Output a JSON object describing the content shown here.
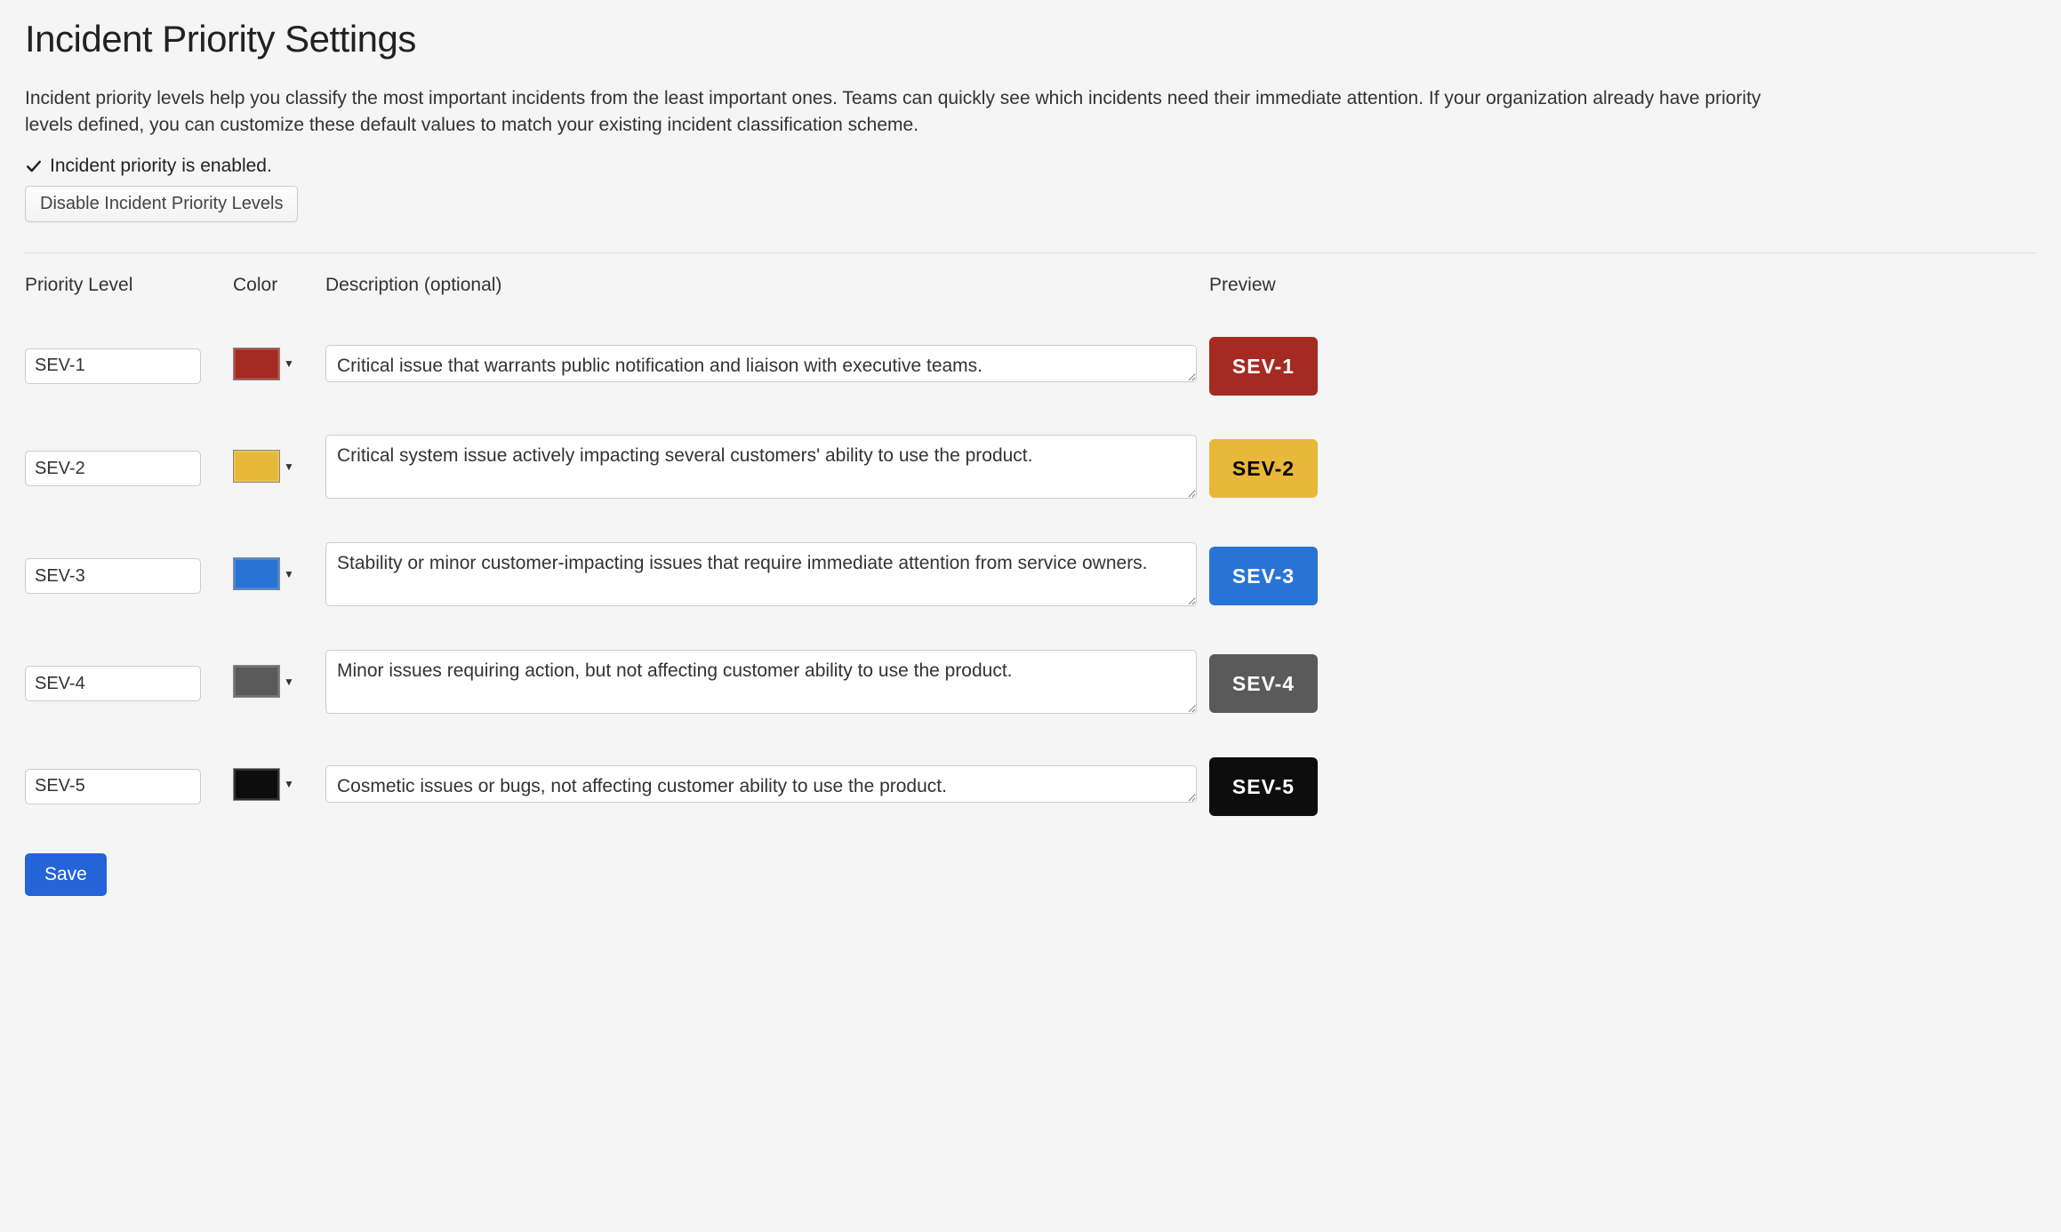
{
  "page": {
    "title": "Incident Priority Settings",
    "intro": "Incident priority levels help you classify the most important incidents from the least important ones. Teams can quickly see which incidents need their immediate attention. If your organization already have priority levels defined, you can customize these default values to match your existing incident classification scheme.",
    "status_text": "Incident priority is enabled.",
    "disable_button": "Disable Incident Priority Levels",
    "save_button": "Save"
  },
  "columns": {
    "name": "Priority Level",
    "color": "Color",
    "description": "Description (optional)",
    "preview": "Preview"
  },
  "priorities": [
    {
      "name": "SEV-1",
      "color": "#a52a21",
      "text_color": "#ffffff",
      "description": "Critical issue that warrants public notification and liaison with executive teams.",
      "preview_label": "SEV-1",
      "multiline": false
    },
    {
      "name": "SEV-2",
      "color": "#e8b839",
      "text_color": "#000000",
      "description": "Critical system issue actively impacting several customers' ability to use the product.",
      "preview_label": "SEV-2",
      "multiline": true
    },
    {
      "name": "SEV-3",
      "color": "#2874d4",
      "text_color": "#ffffff",
      "description": "Stability or minor customer-impacting issues that require immediate attention from service owners.",
      "preview_label": "SEV-3",
      "multiline": true
    },
    {
      "name": "SEV-4",
      "color": "#5a5a5a",
      "text_color": "#ffffff",
      "description": "Minor issues requiring action, but not affecting customer ability to use the product.",
      "preview_label": "SEV-4",
      "multiline": true
    },
    {
      "name": "SEV-5",
      "color": "#0d0d0d",
      "text_color": "#ffffff",
      "description": "Cosmetic issues or bugs, not affecting customer ability to use the product.",
      "preview_label": "SEV-5",
      "multiline": false
    }
  ]
}
